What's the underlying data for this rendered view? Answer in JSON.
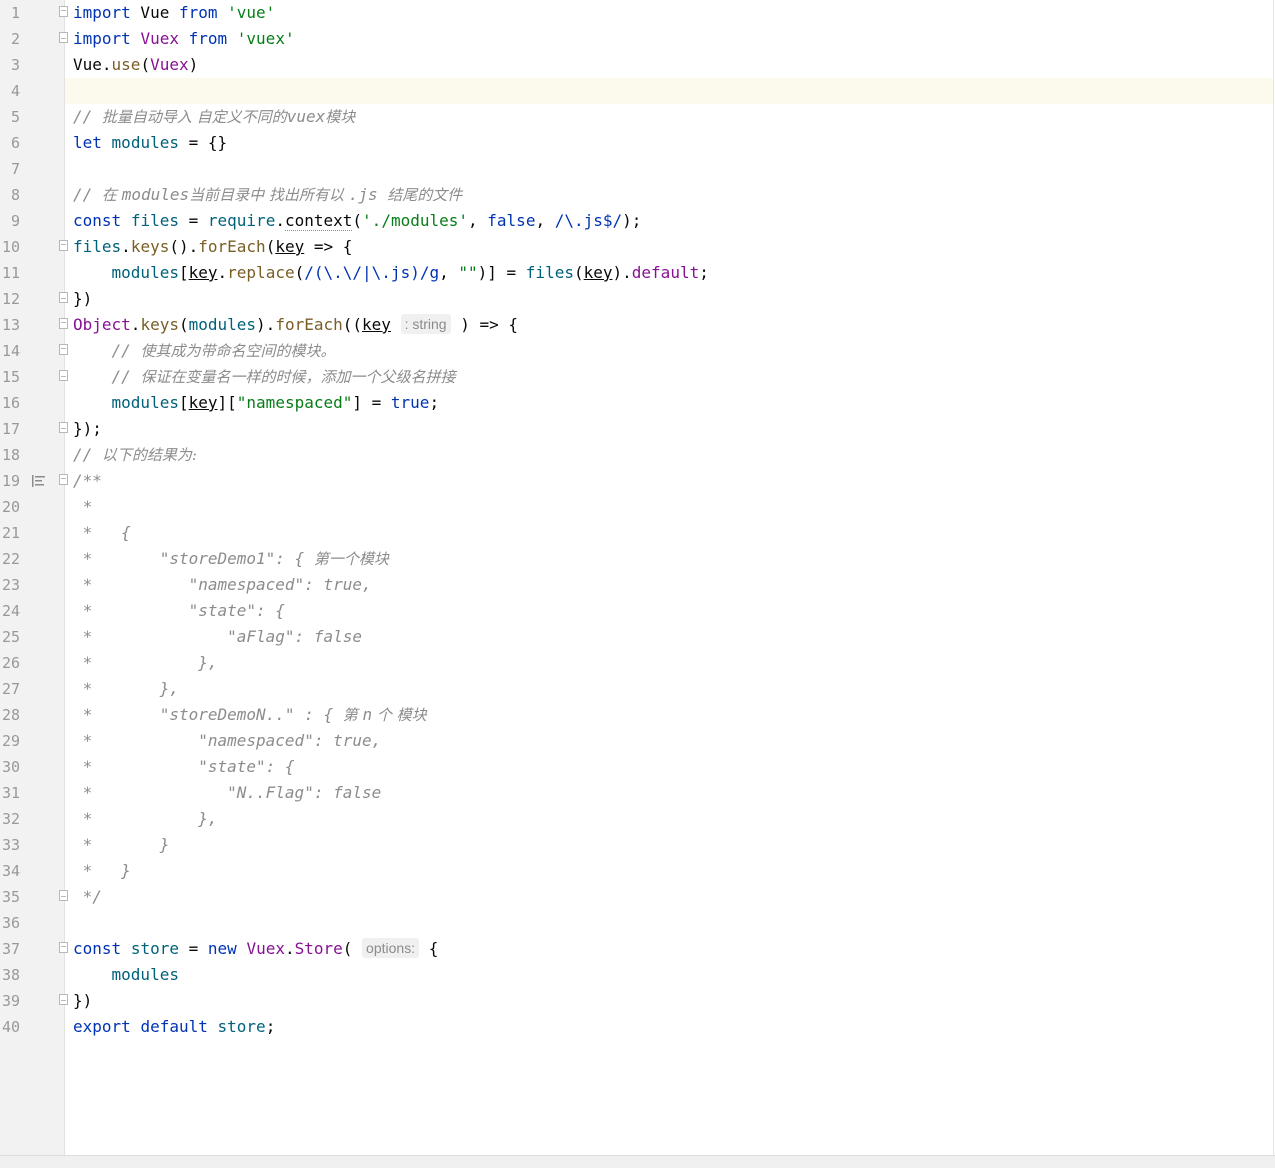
{
  "editor": {
    "line_numbers": [
      "1",
      "2",
      "3",
      "4",
      "5",
      "6",
      "7",
      "8",
      "9",
      "10",
      "11",
      "12",
      "13",
      "14",
      "15",
      "16",
      "17",
      "18",
      "19",
      "20",
      "21",
      "22",
      "23",
      "24",
      "25",
      "26",
      "27",
      "28",
      "29",
      "30",
      "31",
      "32",
      "33",
      "34",
      "35",
      "36",
      "37",
      "38",
      "39",
      "40"
    ],
    "current_line": "4",
    "line1": {
      "t1": "import",
      "t2": " Vue ",
      "t3": "from",
      "t4": " ",
      "t5": "'vue'"
    },
    "line2": {
      "t1": "import",
      "t2": " ",
      "t3": "Vuex",
      "t4": " ",
      "t5": "from",
      "t6": " ",
      "t7": "'vuex'"
    },
    "line3": {
      "t1": "Vue.",
      "t2": "use",
      "t3": "(",
      "t4": "Vuex",
      "t5": ")"
    },
    "line5": {
      "t1": "// ",
      "t2": "批量自动导入 自定义不同的",
      "t3": "vuex",
      "t4": "模块"
    },
    "line6": {
      "t1": "let",
      "t2": " ",
      "t3": "modules",
      "t4": " = {}"
    },
    "line8": {
      "t1": "// ",
      "t2": "在 ",
      "t3": "modules",
      "t4": "当前目录中 找出所有以 ",
      "t5": ".js ",
      "t6": "结尾的文件"
    },
    "line9": {
      "t1": "const",
      "t2": " ",
      "t3": "files",
      "t4": " = ",
      "t5": "require",
      "t6": ".",
      "t7": "context",
      "t8": "(",
      "t9": "'./modules'",
      "t10": ", ",
      "t11": "false",
      "t12": ", ",
      "t13": "/\\.js$/",
      "t14": ");"
    },
    "line10": {
      "t1": "files",
      "t2": ".",
      "t3": "keys",
      "t4": "().",
      "t5": "forEach",
      "t6": "(",
      "t7": "key",
      "t8": " => {"
    },
    "line11": {
      "t1": "    ",
      "t2": "modules",
      "t3": "[",
      "t4": "key",
      "t5": ".",
      "t6": "replace",
      "t7": "(",
      "t8": "/(\\.\\/|\\.js)/g",
      "t9": ", ",
      "t10": "\"\"",
      "t11": ")] = ",
      "t12": "files",
      "t13": "(",
      "t14": "key",
      "t15": ").",
      "t16": "default",
      "t17": ";"
    },
    "line12": {
      "t1": "})"
    },
    "line13": {
      "t1": "Object",
      "t2": ".",
      "t3": "keys",
      "t4": "(",
      "t5": "modules",
      "t6": ").",
      "t7": "forEach",
      "t8": "((",
      "t9": "key",
      "t10": " ",
      "t11": ": string",
      "t12": " ) => {"
    },
    "line14": {
      "t1": "    // ",
      "t2": "使其成为带命名空间的模块。"
    },
    "line15": {
      "t1": "    // ",
      "t2": "保证在变量名一样的时候，添加一个父级名拼接"
    },
    "line16": {
      "t1": "    ",
      "t2": "modules",
      "t3": "[",
      "t4": "key",
      "t5": "][",
      "t6": "\"namespaced\"",
      "t7": "] = ",
      "t8": "true",
      "t9": ";"
    },
    "line17": {
      "t1": "});"
    },
    "line18": {
      "t1": "// ",
      "t2": "以下的结果为:"
    },
    "line19": {
      "t1": "/**"
    },
    "line20": {
      "t1": " *"
    },
    "line21": {
      "t1": " *   {"
    },
    "line22": {
      "t1": " *       \"storeDemo1\": { ",
      "t2": "第一个模块"
    },
    "line23": {
      "t1": " *          \"namespaced\": true,"
    },
    "line24": {
      "t1": " *          \"state\": {"
    },
    "line25": {
      "t1": " *              \"aFlag\": false"
    },
    "line26": {
      "t1": " *           },"
    },
    "line27": {
      "t1": " *       },"
    },
    "line28": {
      "t1": " *       \"storeDemoN..\" : { ",
      "t2": "第 ",
      "t3": "n",
      "t4": " 个 模块"
    },
    "line29": {
      "t1": " *           \"namespaced\": true,"
    },
    "line30": {
      "t1": " *           \"state\": {"
    },
    "line31": {
      "t1": " *              \"N..Flag\": false"
    },
    "line32": {
      "t1": " *           },"
    },
    "line33": {
      "t1": " *       }"
    },
    "line34": {
      "t1": " *   }"
    },
    "line35": {
      "t1": " */"
    },
    "line37": {
      "t1": "const",
      "t2": " ",
      "t3": "store",
      "t4": " = ",
      "t5": "new",
      "t6": " ",
      "t7": "Vuex",
      "t8": ".",
      "t9": "Store",
      "t10": "( ",
      "t11": "options:",
      "t12": " {"
    },
    "line38": {
      "t1": "    ",
      "t2": "modules"
    },
    "line39": {
      "t1": "})"
    },
    "line40": {
      "t1": "export",
      "t2": " ",
      "t3": "default",
      "t4": " ",
      "t5": "store",
      "t6": ";"
    }
  },
  "colors": {
    "keyword": "#0033b3",
    "string": "#067d17",
    "function": "#00627a",
    "method": "#795e26",
    "variable": "#871094",
    "comment": "#8c8c8c",
    "current_line": "#fcfaed",
    "gutter": "#f2f2f2"
  },
  "icons": {
    "fold_marker": "fold-marker-icon",
    "doc_comment": "doc-comment-icon"
  }
}
